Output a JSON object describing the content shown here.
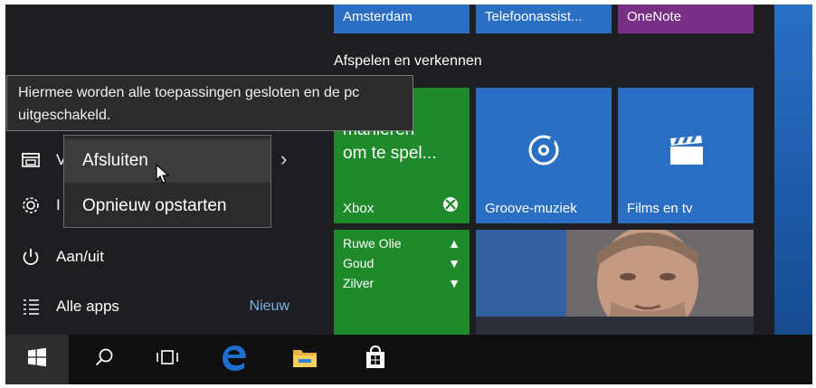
{
  "tooltip": {
    "line1": "Hiermee worden alle toepassingen gesloten en de pc",
    "line2": "uitgeschakeld."
  },
  "power_menu": {
    "shutdown": "Afsluiten",
    "restart": "Opnieuw opstarten"
  },
  "left": {
    "explorer_initial": "V",
    "settings_initial": "I",
    "power": "Aan/uit",
    "all_apps": "Alle apps",
    "new_badge": "Nieuw",
    "chevron": "›"
  },
  "tiles": {
    "amsterdam": "Amsterdam",
    "telefoon": "Telefoonassist...",
    "onenote": "OneNote",
    "section": "Afspelen en verkennen",
    "xbox_line1": "manieren",
    "xbox_line2": "om te spel...",
    "xbox": "Xbox",
    "groove": "Groove-muziek",
    "films": "Films en tv",
    "stocks": [
      {
        "name": "Ruwe Olie",
        "dir": "▲"
      },
      {
        "name": "Goud",
        "dir": "▼"
      },
      {
        "name": "Zilver",
        "dir": "▼"
      }
    ]
  },
  "colors": {
    "blue_tile": "#2a6fc4",
    "purple_tile": "#7a2f86",
    "green_tile": "#1f8a2c",
    "edge_blue": "#1e6fd0"
  },
  "icons": [
    "windows-logo-icon",
    "search-icon",
    "task-view-icon",
    "edge-icon",
    "file-explorer-icon",
    "store-icon",
    "power-icon",
    "settings-icon",
    "all-apps-icon",
    "groove-icon",
    "films-icon",
    "xbox-logo-icon"
  ]
}
